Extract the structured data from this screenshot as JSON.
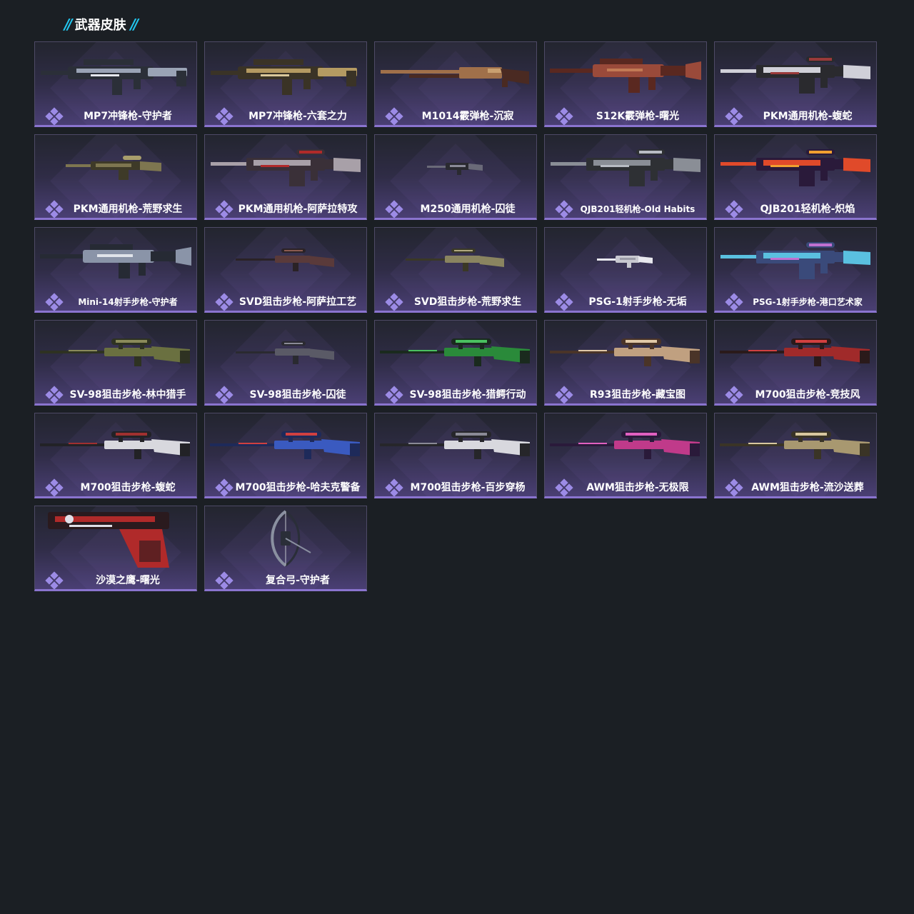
{
  "section": {
    "title": "武器皮肤",
    "decoration": "//",
    "accent_color": "#22c6ee"
  },
  "colors": {
    "card_border": "#4e4a66",
    "card_underline": "#8a74cf",
    "rarity_icon": "#9c8be6"
  },
  "skins": [
    {
      "name": "MP7冲锋枪-守护者",
      "weapon": "smg",
      "palette": [
        "#2b2f38",
        "#9aa3b5",
        "#e6e8ee"
      ]
    },
    {
      "name": "MP7冲锋枪-六套之力",
      "weapon": "smg",
      "palette": [
        "#3a3326",
        "#b49a62",
        "#d9c79a"
      ]
    },
    {
      "name": "M1014霰弹枪-沉寂",
      "weapon": "shotgun",
      "palette": [
        "#4a2a22",
        "#a0704a",
        "#c9a070"
      ]
    },
    {
      "name": "S12K霰弹枪-曙光",
      "weapon": "rifle",
      "palette": [
        "#5a2820",
        "#9a4a3a",
        "#c27a55"
      ]
    },
    {
      "name": "PKM通用机枪-蝮蛇",
      "weapon": "lmg",
      "palette": [
        "#2a2a2e",
        "#d0d0d8",
        "#9a3a3a"
      ]
    },
    {
      "name": "PKM通用机枪-荒野求生",
      "weapon": "lmg-small",
      "palette": [
        "#3e3a28",
        "#7e7650",
        "#a89e6c"
      ]
    },
    {
      "name": "PKM通用机枪-阿萨拉特攻",
      "weapon": "lmg",
      "palette": [
        "#3a3038",
        "#a8a0a8",
        "#b02a2a"
      ]
    },
    {
      "name": "M250通用机枪-囚徒",
      "weapon": "tiny",
      "palette": [
        "#2a2a30",
        "#6a6a78",
        "#8a8a98"
      ]
    },
    {
      "name": "QJB201轻机枪-Old Habits",
      "weapon": "lmg",
      "palette": [
        "#2e3034",
        "#8a8e96",
        "#b8bcc4"
      ]
    },
    {
      "name": "QJB201轻机枪-炽焰",
      "weapon": "lmg",
      "palette": [
        "#2a1a3a",
        "#e04a2a",
        "#f0a030"
      ]
    },
    {
      "name": "Mini-14射手步枪-守护者",
      "weapon": "rifle",
      "palette": [
        "#262a34",
        "#8a94a8",
        "#e0e4ea"
      ]
    },
    {
      "name": "SVD狙击步枪-阿萨拉工艺",
      "weapon": "sniper-small",
      "palette": [
        "#2a2226",
        "#5a3a3a",
        "#8a5a50"
      ]
    },
    {
      "name": "SVD狙击步枪-荒野求生",
      "weapon": "sniper-small",
      "palette": [
        "#3a3826",
        "#8a8460",
        "#b0a880"
      ]
    },
    {
      "name": "PSG-1射手步枪-无垢",
      "weapon": "tiny",
      "palette": [
        "#c8c8d0",
        "#e8e8ee",
        "#9a9aa6"
      ]
    },
    {
      "name": "PSG-1射手步枪-港口艺术家",
      "weapon": "lmg",
      "palette": [
        "#3a4a7a",
        "#5ac0e0",
        "#c070d0"
      ]
    },
    {
      "name": "SV-98狙击步枪-林中猎手",
      "weapon": "sniper",
      "palette": [
        "#2e3222",
        "#6a7040",
        "#8a8a5a"
      ]
    },
    {
      "name": "SV-98狙击步枪-囚徒",
      "weapon": "sniper-small",
      "palette": [
        "#2a2a30",
        "#5a5a66",
        "#8a8a96"
      ]
    },
    {
      "name": "SV-98狙击步枪-猎鳄行动",
      "weapon": "sniper",
      "palette": [
        "#1a2a1e",
        "#2a8a3a",
        "#4ac060"
      ]
    },
    {
      "name": "R93狙击步枪-藏宝图",
      "weapon": "sniper",
      "palette": [
        "#4a3428",
        "#c0a080",
        "#e0c8a8"
      ]
    },
    {
      "name": "M700狙击步枪-竞技风",
      "weapon": "sniper",
      "palette": [
        "#2a1a1a",
        "#a02a2a",
        "#d04040"
      ]
    },
    {
      "name": "M700狙击步枪-蝮蛇",
      "weapon": "sniper",
      "palette": [
        "#222226",
        "#d8d8de",
        "#a03030"
      ]
    },
    {
      "name": "M700狙击步枪-哈夫克警备",
      "weapon": "sniper",
      "palette": [
        "#1e2a5a",
        "#3a5ac0",
        "#d04040"
      ]
    },
    {
      "name": "M700狙击步枪-百步穿杨",
      "weapon": "sniper",
      "palette": [
        "#26262a",
        "#d8d8de",
        "#8a8a96"
      ]
    },
    {
      "name": "AWM狙击步枪-无极限",
      "weapon": "sniper",
      "palette": [
        "#2a1a3a",
        "#c03a8a",
        "#e060c0"
      ]
    },
    {
      "name": "AWM狙击步枪-流沙送葬",
      "weapon": "sniper",
      "palette": [
        "#3a3426",
        "#a89870",
        "#d8c8a0"
      ]
    },
    {
      "name": "沙漠之鹰-曙光",
      "weapon": "pistol",
      "palette": [
        "#2a1a1e",
        "#b02a2a",
        "#e0e0e8"
      ]
    },
    {
      "name": "复合弓-守护者",
      "weapon": "bow",
      "palette": [
        "#2a2e38",
        "#8a90a0",
        "#c0c4cc"
      ]
    }
  ]
}
